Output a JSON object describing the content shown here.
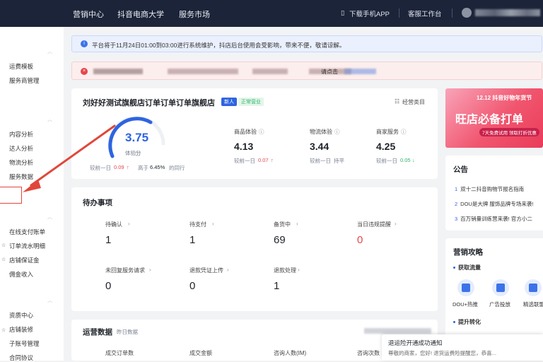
{
  "topbar": {
    "nav": [
      "营销中心",
      "抖音电商大学",
      "服务市场"
    ],
    "download_app": "下载手机APP",
    "service_desk": "客服工作台"
  },
  "sidebar": {
    "items": [
      "运费模板",
      "服务商管理",
      "内容分析",
      "达人分析",
      "物流分析",
      "服务数据",
      "在线支付账单",
      "订单流水明细",
      "店铺保证金",
      "佣金收入",
      "资质中心",
      "店铺装修",
      "子账号管理",
      "合同协议"
    ]
  },
  "notice_banner": {
    "text": "平台将于11月24日01:00到03:00进行系统维护，抖店后台使用会受影响，带来不便，敬请谅解。"
  },
  "alert_banner": {
    "link_fragment": "请点击"
  },
  "shop": {
    "name": "刘好好测试旗舰店订单订单订单旗舰店",
    "tag_new": "新人",
    "tag_status": "正常营业",
    "ops_link": "经营类目",
    "experience_score": "3.75",
    "score_label": "体验分",
    "compare_prev": "较前一日",
    "compare_prev_val": "0.09",
    "higher_than": "高于",
    "higher_than_val": "6.45%",
    "higher_than_suffix": "的同行",
    "metrics": [
      {
        "label": "商品体验",
        "value": "4.13",
        "compare": "较前一日",
        "delta": "0.07",
        "dir": "up"
      },
      {
        "label": "物流体验",
        "value": "3.44",
        "compare": "较前一日",
        "delta": "持平",
        "dir": "flat"
      },
      {
        "label": "商家服务",
        "value": "4.25",
        "compare": "较前一日",
        "delta": "0.05",
        "dir": "down"
      }
    ]
  },
  "todo": {
    "title": "待办事项",
    "items": [
      {
        "label": "待确认",
        "value": "1"
      },
      {
        "label": "待支付",
        "value": "1"
      },
      {
        "label": "备货中",
        "value": "69"
      },
      {
        "label": "当日违规提醒",
        "value": "0"
      },
      {
        "label": "未回复服务请求",
        "value": "0"
      },
      {
        "label": "退款凭证上传",
        "value": "0"
      },
      {
        "label": "退款处理",
        "value": "1"
      }
    ]
  },
  "ops_data": {
    "title": "运营数据",
    "subtitle": "昨日数据",
    "columns": [
      "成交订单数",
      "成交金额",
      "咨询人数(IM)",
      "咨询次数"
    ]
  },
  "right_banner": {
    "top_text": "12.12 抖音好物年货节",
    "main_text": "旺店必备打单",
    "sub_text": "7天免费试用 领取打折优惠"
  },
  "announcement": {
    "title": "公告",
    "items": [
      {
        "num": "1",
        "text": "双十二抖音购物节报名指南"
      },
      {
        "num": "2",
        "text": "DOU是大牌 服饰品牌专场来袭!"
      },
      {
        "num": "3",
        "text": "百万销量训练营来袭! 官方小二"
      }
    ]
  },
  "marketing": {
    "title": "营销攻略",
    "sub1": "获取流量",
    "sub2": "提升转化",
    "tools": [
      "DOU+热推",
      "广告投放",
      "精选联盟"
    ]
  },
  "popup": {
    "title": "退运险开通成功通知",
    "body": "尊敬的商家，您好! 退货运费险提醒您，恭喜..."
  },
  "colors": {
    "primary": "#2e64e0",
    "danger": "#e5484d",
    "success": "#2fb46a",
    "topbar": "#1b2438"
  }
}
